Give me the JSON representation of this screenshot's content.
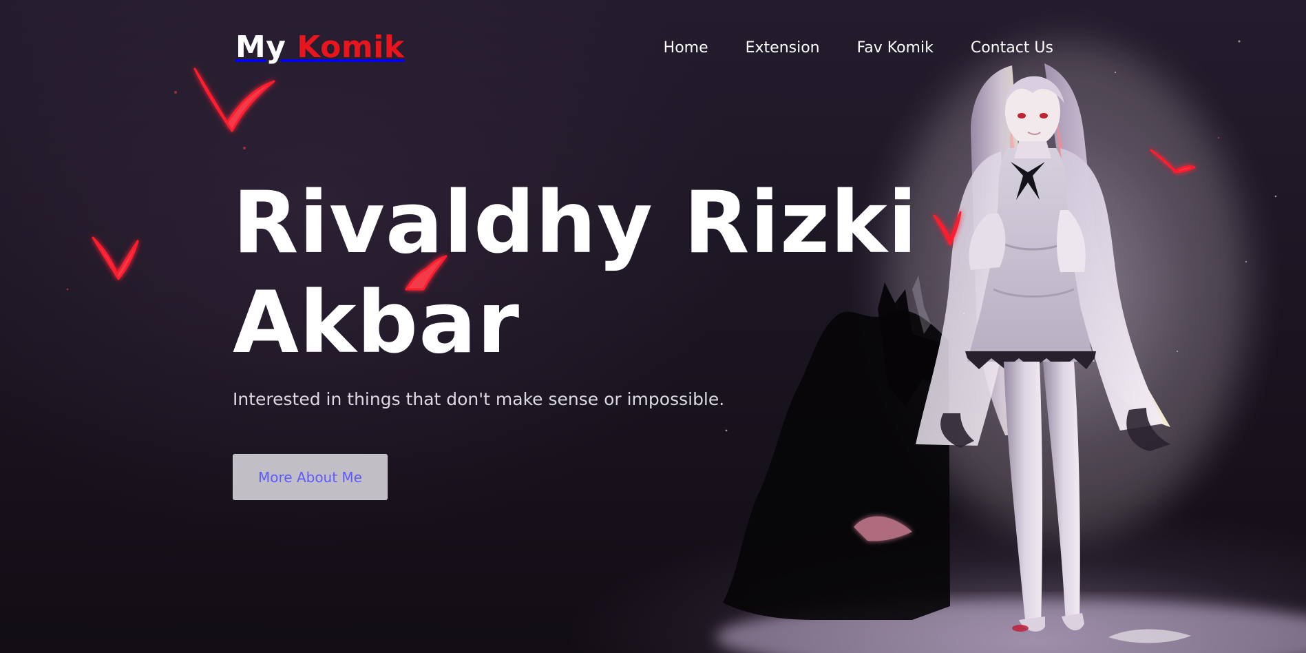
{
  "navbar": {
    "brand_my": "My",
    "brand_komik": "Komik",
    "links": [
      {
        "label": "Home"
      },
      {
        "label": "Extension"
      },
      {
        "label": "Fav Komik"
      },
      {
        "label": "Contact Us"
      }
    ]
  },
  "hero": {
    "title_line1": "Rivaldhy Rizki",
    "title_line2": "Akbar",
    "subtitle": "Interested in things that don't make sense or impossible.",
    "cta_label": "More About Me"
  },
  "colors": {
    "brand_accent": "#e8141e",
    "button_bg": "#c1bfc5",
    "button_text": "#5d5aff",
    "background": "#140f18"
  }
}
